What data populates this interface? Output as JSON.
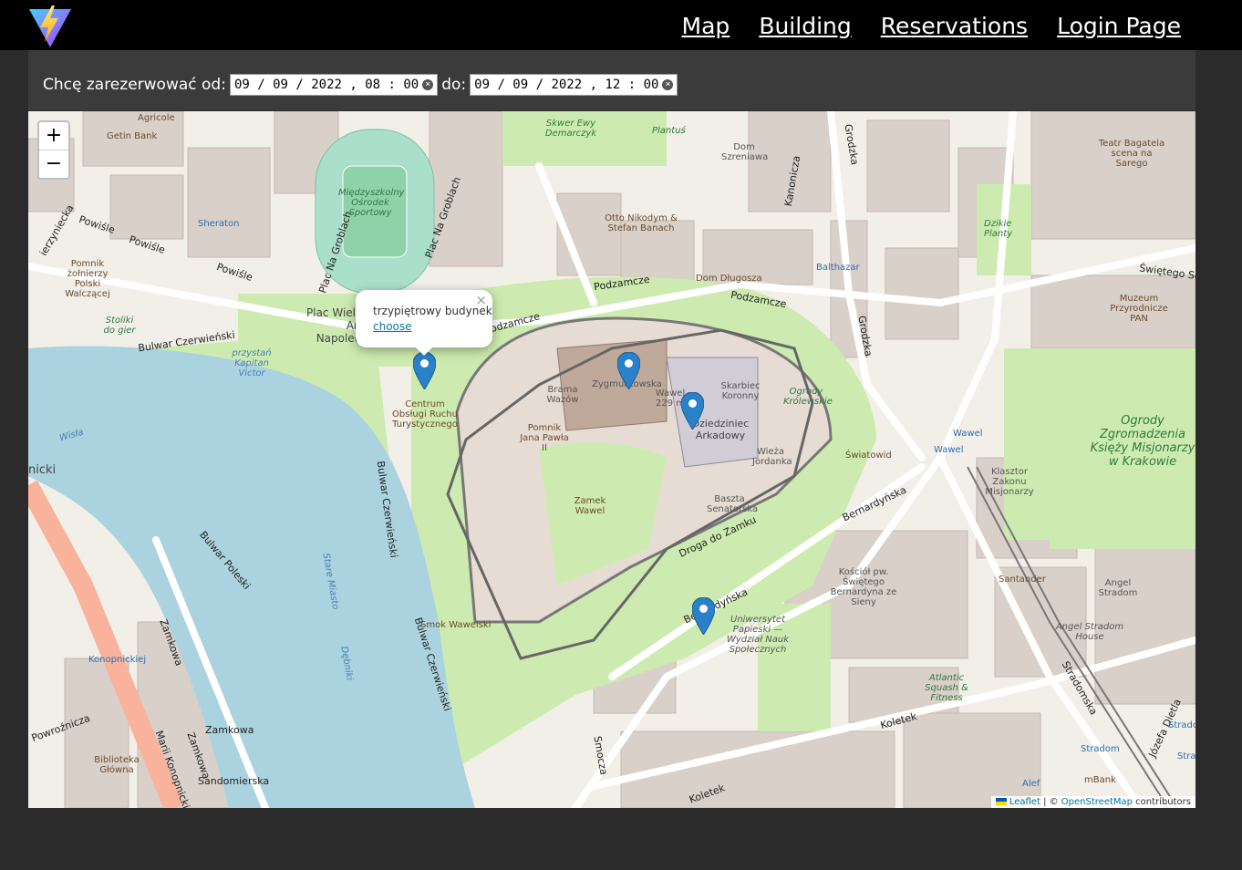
{
  "navbar": {
    "links": [
      "Map",
      "Building",
      "Reservations",
      "Login Page"
    ]
  },
  "filter": {
    "from_label": "Chcę zarezerwować od:",
    "from_value": "09 / 09 / 2022 ,  08 : 00",
    "to_label": "do:",
    "to_value": "09 / 09 / 2022 ,  12 : 00"
  },
  "map": {
    "zoom_in": "+",
    "zoom_out": "−",
    "popup": {
      "text": "trzypiętrowy budynek",
      "link": "choose",
      "close": "×"
    },
    "attribution": {
      "leaflet": "Leaflet",
      "sep": " | © ",
      "osm": "OpenStreetMap",
      "suffix": " contributors"
    },
    "labels": {
      "agricole": "Agricole",
      "getin": "Getin Bank",
      "sheraton": "Sheraton",
      "stadium": "Międzyszkolny Ośrodek Sportowy",
      "plac_grob1": "Plac Na Groblach",
      "plac_grob2": "Plac Na Groblach",
      "powisle1": "Powiśle",
      "powisle2": "Powiśle",
      "powisle3": "Powiśle",
      "pomnik_zolnierzy": "Pomnik żołnierzy Polski Walczącej",
      "stoliki": "Stoliki do gier",
      "plac_wielki": "Plac Wielkiej Armii Napoleona",
      "bulwar_czerw": "Bulwar Czerwieński",
      "przystan": "przystań Kapitan Victor",
      "wisla": "Wisła",
      "skwer": "Skwer Ewy Demarczyk",
      "plantus": "Plantuś",
      "dom_szreniawa": "Dom Szreniawa",
      "kanonicza": "Kanonicza",
      "grodzka": "Grodzka",
      "grodzka2": "Grodzka",
      "bagatela": "Teatr Bagatela scena na Sarego",
      "dzikie": "Dzikie Planty",
      "otto": "Otto Nikodym & Stefan Banach",
      "dom_dlugosza": "Dom Długosza",
      "balthazar": "Balthazar",
      "swietego": "Świętego Se",
      "muzeum": "Muzeum Przyrodnicze PAN",
      "podzamcze1": "Podzamcze",
      "podzamcze2": "Podzamcze",
      "podzamcze3": "Podzamcze",
      "centrum": "Centrum Obsługi Ruchu Turystycznego",
      "brama": "Brama Wazów",
      "zygmuntowska": "Zygmuntowska",
      "wawel_229": "Wawel 229 m",
      "skarbiec": "Skarbiec Koronny",
      "ogrod_krol": "Ogrody Królewskie",
      "dziedziniec": "Dziedziniec Arkadowy",
      "pomnik_jp": "Pomnik Jana Pawła II",
      "wieza": "Wieża Jordanka",
      "swiatowid": "Światowid",
      "zamek": "Zamek Wawel",
      "baszta": "Baszta Senatorska",
      "droga": "Droga do Zamku",
      "ogrody_ksiezy": "Ogrody Zgromadzenia Księży Misjonarzy w Krakowie",
      "klasztor": "Klasztor Zakonu Misjonarzy",
      "bernardynska1": "Bernardyńska",
      "bernardynska2": "Bernardyńska",
      "kosciol": "Kościół pw. Świętego Bernardyna ze Sieny",
      "santander": "Santander",
      "angel": "Angel Stradom",
      "angel2": "Angel Stradom House",
      "upap": "Uniwersytet Papieski — Wydział Nauk Społecznych",
      "smok": "Smok Wawelski",
      "bulwar_czerw2": "Bulwar Czerwieński",
      "bulwar_czerw3": "Bulwar Czerwieński",
      "stare_miasto": "Stare Miasto",
      "debniki": "Dębniki",
      "nicki": "nicki",
      "bulwar_pol": "Bulwar Poleski",
      "zamkowa": "Zamkowa",
      "zamkowa2": "Zamkowa",
      "zamkowa3": "Zamkowa",
      "konopnickiej": "Konopnickiej",
      "mari_konop": "Marii Konopnickiej",
      "powroznicza": "Powroźnicza",
      "biblioteka": "Biblioteka Główna",
      "sandomierska": "Sandomierska",
      "smocza": "Smocza",
      "koletek": "Koletek",
      "koletek2": "Koletek",
      "atlantic": "Atlantic Squash & Fitness",
      "stradomska": "Stradomska",
      "jozefa": "Józefa Dietla",
      "stradom": "Stradom",
      "mbank": "mBank",
      "alef": "Alef",
      "wawel_stop": "Wawel",
      "wawel_stop2": "Wawel",
      "stradom2": "Stradom",
      "stra": "Stra",
      "wierzynieck": "ierzyniecka"
    }
  }
}
